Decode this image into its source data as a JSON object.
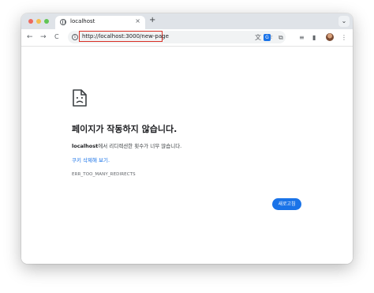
{
  "tab": {
    "title": "localhost",
    "close": "×",
    "new_tab": "+",
    "menu": "⌄"
  },
  "toolbar": {
    "back": "←",
    "forward": "→",
    "reload": "C",
    "url": "http://localhost:3000/new-page",
    "info_icon": "i",
    "translate_icon": "文",
    "bookmark_icon": "☆",
    "extensions_icon": "⧉",
    "media_icon": "≡",
    "sidepanel_icon": "▮",
    "menu_icon": "⋮"
  },
  "error": {
    "title": "페이지가 작동하지 않습니다.",
    "host": "localhost",
    "description": "에서 리디렉션한 횟수가 너무 많습니다.",
    "link": "쿠키 삭제해 보기.",
    "code": "ERR_TOO_MANY_REDIRECTS",
    "reload_button": "새로고침"
  },
  "colors": {
    "accent": "#1a73e8",
    "highlight_border": "#d93025"
  }
}
